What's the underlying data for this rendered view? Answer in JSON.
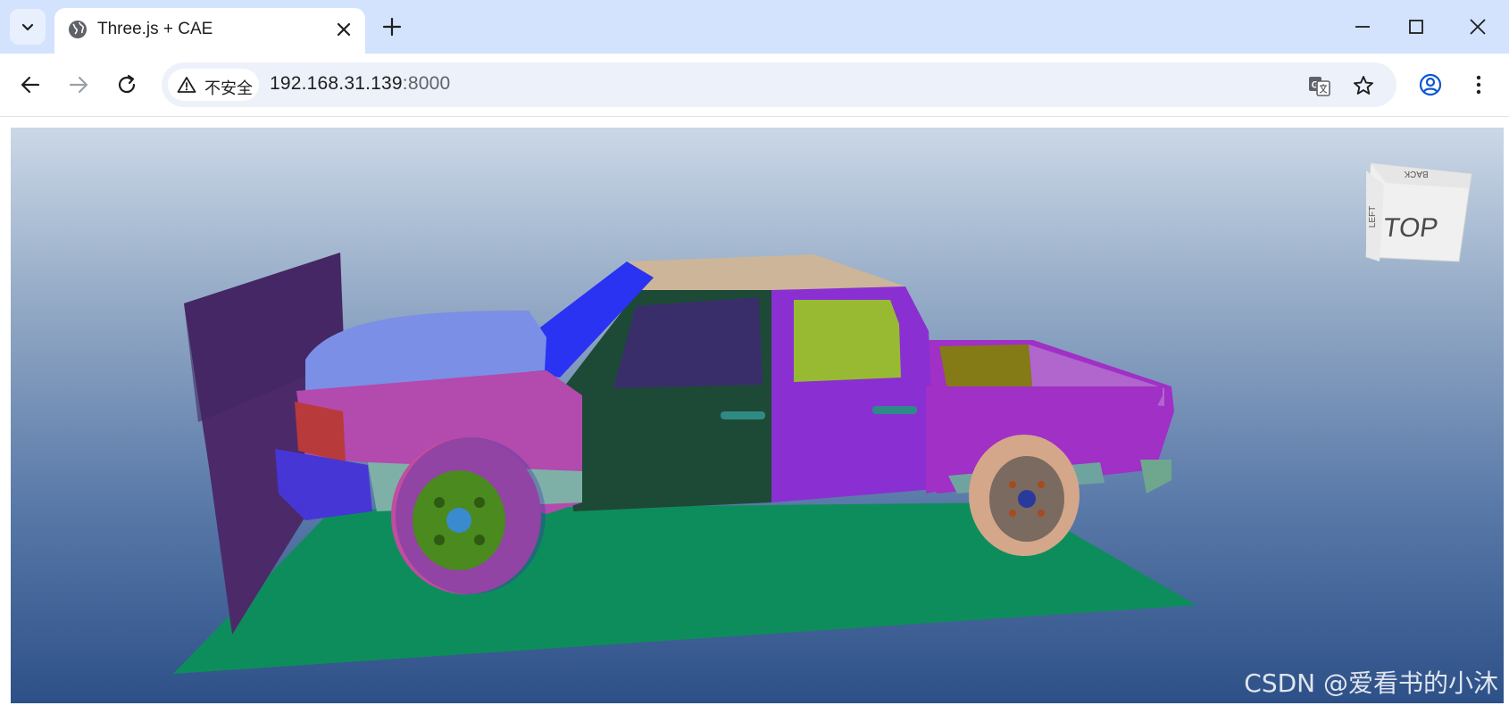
{
  "browser": {
    "tab": {
      "title": "Three.js + CAE",
      "favicon": "globe-icon",
      "close": "close-icon"
    },
    "new_tab": "plus-icon",
    "controls": [
      "chevron-down-icon",
      "minimize-icon",
      "maximize-icon",
      "close-window-icon"
    ],
    "toolbar": {
      "back": "back-arrow-icon",
      "forward": "forward-arrow-icon",
      "reload": "reload-icon",
      "security_label": "不安全",
      "url_host": "192.168.31.139",
      "url_port": ":8000",
      "translate": "translate-icon",
      "bookmark": "star-icon",
      "profile": "profile-icon",
      "menu": "kebab-menu-icon"
    }
  },
  "viewer": {
    "view_cube": {
      "face_top": "TOP",
      "face_back": "BACK",
      "face_left": "LEFT"
    },
    "colors": {
      "ground": "#0e8d5c",
      "hood": "#7b8fe6",
      "fender_front": "#b34aad",
      "door_front": "#1d4a36",
      "door_rear": "#8a2fd2",
      "bed": "#a030c6",
      "roof": "#cdb59a",
      "windshield": "#2a33f2",
      "rear_window": "#98ba33",
      "tire_front": "#c04da0",
      "tire_rear": "#d4a78a",
      "wheel": "#4a8a1e"
    }
  },
  "watermark": "CSDN @爱看书的小沐"
}
